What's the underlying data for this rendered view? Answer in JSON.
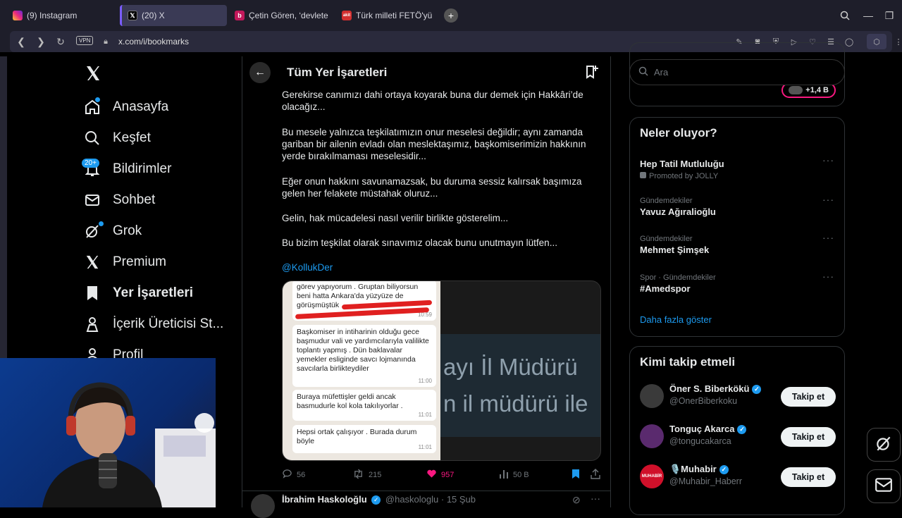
{
  "browser": {
    "tabs": [
      {
        "label": "(9) Instagram",
        "icon": "instagram-icon"
      },
      {
        "label": "(20) X",
        "icon": "x-icon"
      },
      {
        "label": "Çetin Gören, ‘devlete yard",
        "icon": "news-icon"
      },
      {
        "label": "Türk milleti FETÖ'yü affede",
        "icon": "akit-icon",
        "icon_text": "akit"
      }
    ],
    "url": "x.com/i/bookmarks",
    "vpn_label": "VPN"
  },
  "sidebar": {
    "items": [
      {
        "label": "Anasayfa",
        "icon": "home-icon"
      },
      {
        "label": "Keşfet",
        "icon": "search-icon"
      },
      {
        "label": "Bildirimler",
        "icon": "bell-icon",
        "badge": "20+"
      },
      {
        "label": "Sohbet",
        "icon": "mail-icon"
      },
      {
        "label": "Grok",
        "icon": "grok-icon"
      },
      {
        "label": "Premium",
        "icon": "x-icon"
      },
      {
        "label": "Yer İşaretleri",
        "icon": "bookmark-icon"
      },
      {
        "label": "İçerik Üreticisi St...",
        "icon": "creator-studio-icon"
      },
      {
        "label": "Profil",
        "icon": "person-icon"
      }
    ]
  },
  "main": {
    "title": "Tüm Yer İşaretleri",
    "tweet": {
      "paragraphs": [
        "Gerekirse canımızı dahi ortaya koyarak buna dur demek için Hakkâri’de olacağız...",
        "Bu mesele yalnızca teşkilatımızın onur meselesi değildir; aynı zamanda gariban bir ailenin evladı olan meslektaşımız, başkomiserimizin hakkının yerde bırakılmaması meselesidir...",
        "Eğer onun hakkını savunamazsak, bu duruma sessiz kalırsak başımıza gelen her felakete müstahak oluruz...",
        "Gelin, hak mücadelesi nasıl verilir birlikte gösterelim...",
        "Bu bizim teşkilat olarak sınavımız olacak bunu unutmayın lütfen..."
      ],
      "mention": "@KollukDer",
      "media": {
        "chat_messages": [
          {
            "text": "görev yapıyorum . Gruptan biliyorsun beni hatta Ankara'da yüzyüze de görüşmüştük",
            "time": "10:59"
          },
          {
            "text": "Başkomiser in intiharinin olduğu gece başmudur vali ve yardımcılarıyla valilikte toplantı yapmış . Dün baklavalar yemekler esliginde savcı lojmanında savcılarla birlikteydiler",
            "time": "11:00"
          },
          {
            "text": "Buraya müfettişler geldi ancak basmudurle kol kola takılıyorlar .",
            "time": "11:01"
          },
          {
            "text": "Hepsi ortak çalışıyor . Burada durum böyle",
            "time": "11:01"
          }
        ],
        "tv_line1": "ayı  İl Müdürü",
        "tv_line2": "n il müdürü ile"
      },
      "stats": {
        "replies": "56",
        "reposts": "215",
        "likes": "957",
        "views": "50 B"
      }
    },
    "next_tweet": {
      "name": "İbrahim Haskoloğlu",
      "handle": "@haskologlu",
      "date": "· 15 Şub"
    }
  },
  "right": {
    "search_placeholder": "Ara",
    "top_pill": "+1,4 B",
    "trends_title": "Neler oluyor?",
    "trends": [
      {
        "category": "",
        "name": "Hep Tatil Mutluluğu",
        "promo": "Promoted by JOLLY"
      },
      {
        "category": "Gündemdekiler",
        "name": "Yavuz Ağıralioğlu"
      },
      {
        "category": "Gündemdekiler",
        "name": "Mehmet Şimşek"
      },
      {
        "category": "Spor · Gündemdekiler",
        "name": "#Amedspor"
      }
    ],
    "show_more": "Daha fazla göster",
    "who_title": "Kimi takip etmeli",
    "who": [
      {
        "name": "Öner S. Biberkökü",
        "handle": "@OnerBiberkoku",
        "button": "Takip et"
      },
      {
        "name": "Tonguç Akarca",
        "handle": "@tongucakarca",
        "button": "Takip et"
      },
      {
        "name": "🎙️Muhabir",
        "handle": "@Muhabir_Haberr",
        "button": "Takip et",
        "avatar_text": "MUHABİR"
      }
    ]
  },
  "colors": {
    "accent": "#1d9bf0",
    "like": "#f91880",
    "background": "#000000"
  }
}
